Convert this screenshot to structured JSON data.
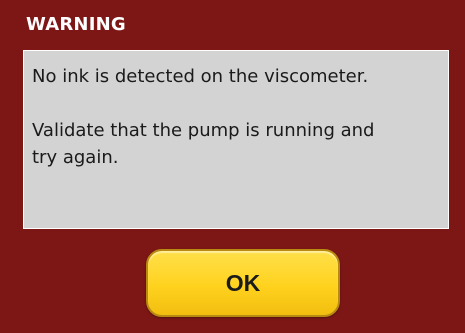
{
  "dialog": {
    "title": "WARNING",
    "message": {
      "line1": "No ink is detected on the viscometer.",
      "line2": "Validate that the pump is running and try again."
    },
    "ok_label": "OK"
  },
  "colors": {
    "background": "#7d1716",
    "message_panel": "#d3d3d3",
    "button": "#ffd21e"
  }
}
